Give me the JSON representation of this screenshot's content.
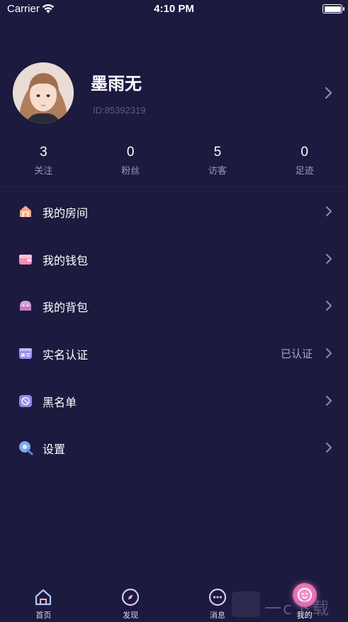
{
  "status_bar": {
    "carrier": "Carrier",
    "time": "4:10 PM"
  },
  "profile": {
    "name": "墨雨无",
    "id_text": "ID:85392319"
  },
  "stats": [
    {
      "value": "3",
      "label": "关注"
    },
    {
      "value": "0",
      "label": "粉丝"
    },
    {
      "value": "5",
      "label": "访客"
    },
    {
      "value": "0",
      "label": "足迹"
    }
  ],
  "menu": [
    {
      "label": "我的房间",
      "icon": "room-icon",
      "value": ""
    },
    {
      "label": "我的钱包",
      "icon": "wallet-icon",
      "value": ""
    },
    {
      "label": "我的背包",
      "icon": "backpack-icon",
      "value": ""
    },
    {
      "label": "实名认证",
      "icon": "id-card-icon",
      "value": "已认证"
    },
    {
      "label": "黑名单",
      "icon": "blacklist-icon",
      "value": ""
    },
    {
      "label": "设置",
      "icon": "settings-icon",
      "value": ""
    }
  ],
  "tabs": [
    {
      "label": "首页",
      "icon": "home-icon"
    },
    {
      "label": "发现",
      "icon": "compass-icon"
    },
    {
      "label": "消息",
      "icon": "message-icon"
    },
    {
      "label": "我的",
      "icon": "profile-icon"
    }
  ],
  "watermark": {
    "text": "一c下载"
  },
  "colors": {
    "background": "#1c1a3f",
    "accent_pink": "#e86bb5",
    "muted_text": "#9a98b8"
  }
}
